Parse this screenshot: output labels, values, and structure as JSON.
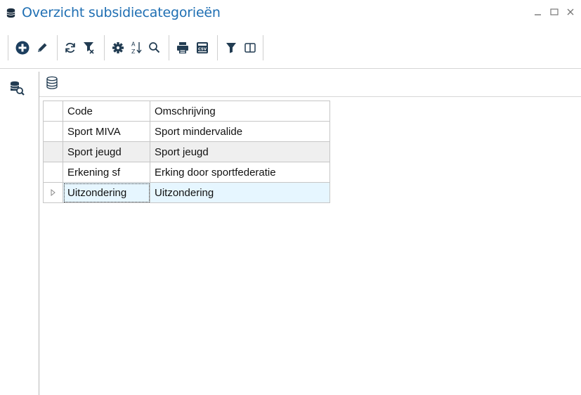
{
  "window": {
    "title": "Overzicht subsidiecategorieën",
    "controls": {
      "minimize": "–",
      "maximize": "□",
      "close": "×"
    }
  },
  "colors": {
    "title": "#1f6fb3",
    "toolbar_icon": "#223c52",
    "add_icon_bg": "#1d3f5f",
    "selected_row": "#e6f6ff",
    "alt_row": "#efefef"
  },
  "toolbar": {
    "buttons": [
      {
        "name": "add",
        "icon": "plus-circle-icon"
      },
      {
        "name": "edit",
        "icon": "pencil-icon"
      },
      {
        "name": "refresh",
        "icon": "refresh-icon"
      },
      {
        "name": "clear-filter",
        "icon": "filter-clear-icon"
      },
      {
        "name": "settings",
        "icon": "gear-icon"
      },
      {
        "name": "sort",
        "icon": "sort-az-icon"
      },
      {
        "name": "search",
        "icon": "search-icon"
      },
      {
        "name": "print",
        "icon": "printer-icon"
      },
      {
        "name": "export-csv",
        "icon": "csv-export-icon",
        "text": "CSV"
      },
      {
        "name": "filter",
        "icon": "filter-icon"
      },
      {
        "name": "columns",
        "icon": "columns-icon"
      }
    ],
    "sort_letters": {
      "a": "A",
      "z": "Z"
    }
  },
  "grid": {
    "columns": [
      "Code",
      "Omschrijving"
    ],
    "rows": [
      {
        "code": "Sport MIVA",
        "description": "Sport mindervalide"
      },
      {
        "code": "Sport jeugd",
        "description": "Sport jeugd"
      },
      {
        "code": "Erkening sf",
        "description": "Erking door sportfederatie"
      },
      {
        "code": "Uitzondering",
        "description": "Uitzondering"
      }
    ],
    "selected_row": 3
  }
}
